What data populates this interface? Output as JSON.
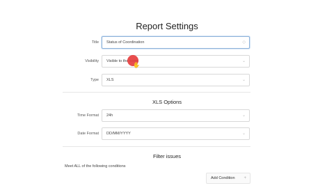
{
  "page": {
    "title": "Report Settings"
  },
  "general": {
    "title_label": "Title",
    "title_value": "Status of Coordination",
    "visibility_label": "Visibility",
    "visibility_value": "Visible to the some",
    "type_label": "Type",
    "type_value": "XLS"
  },
  "xls_options": {
    "heading": "XLS Options",
    "time_format_label": "Time Format",
    "time_format_value": "24h",
    "date_format_label": "Date Format",
    "date_format_value": "DD/MM/YYYY"
  },
  "filter_issues": {
    "heading": "Filter issues",
    "condition_text": "Meet ALL of the following conditions",
    "add_condition_label": "Add Condition",
    "add_icon": "plus-icon"
  },
  "colors": {
    "cursor": "#e63a3a",
    "focus_border": "#8fb3d9"
  }
}
